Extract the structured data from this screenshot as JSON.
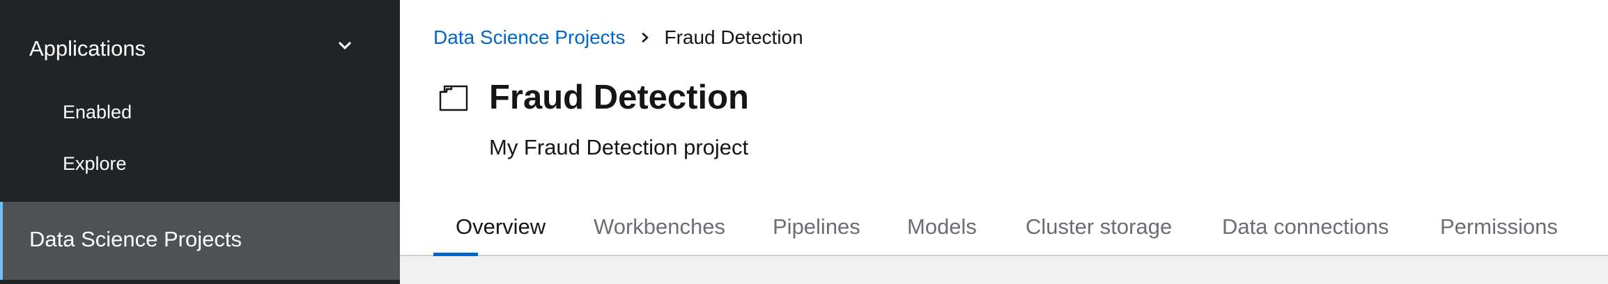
{
  "sidebar": {
    "group_label": "Applications",
    "group_items": [
      {
        "label": "Enabled"
      },
      {
        "label": "Explore"
      }
    ],
    "active_item": "Data Science Projects"
  },
  "breadcrumb": {
    "parent": "Data Science Projects",
    "current": "Fraud Detection"
  },
  "project": {
    "title": "Fraud Detection",
    "description": "My Fraud Detection project"
  },
  "tabs": [
    {
      "label": "Overview",
      "active": true
    },
    {
      "label": "Workbenches"
    },
    {
      "label": "Pipelines"
    },
    {
      "label": "Models"
    },
    {
      "label": "Cluster storage"
    },
    {
      "label": "Data connections"
    },
    {
      "label": "Permissions"
    }
  ],
  "colors": {
    "sidebar_bg": "#212427",
    "sidebar_active_bg": "#4f5255",
    "link": "#0066cc",
    "tab_indicator": "#0066cc"
  },
  "icons": {
    "group_toggle": "chevron-down-icon",
    "breadcrumb_separator": "chevron-right-icon",
    "project": "project-folder-icon"
  }
}
